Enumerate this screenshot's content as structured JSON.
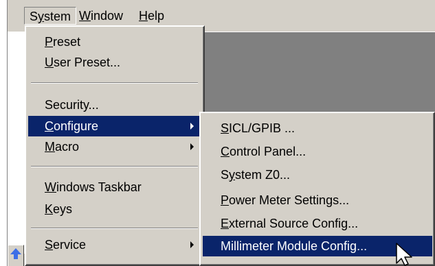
{
  "menubar": {
    "items": [
      {
        "label": "System",
        "mnemonic": "y"
      },
      {
        "label": "Window",
        "mnemonic": "W"
      },
      {
        "label": "Help",
        "mnemonic": "H"
      }
    ]
  },
  "system_menu": {
    "items": [
      {
        "label": "Preset",
        "mnemonic": "P"
      },
      {
        "label": "User Preset...",
        "mnemonic": "U"
      },
      {
        "label": "Security...",
        "mnemonic": ""
      },
      {
        "label": "Configure",
        "mnemonic": "C"
      },
      {
        "label": "Macro",
        "mnemonic": "M"
      },
      {
        "label": "Windows Taskbar",
        "mnemonic": "W"
      },
      {
        "label": "Keys",
        "mnemonic": "K"
      },
      {
        "label": "Service",
        "mnemonic": "S"
      }
    ]
  },
  "configure_submenu": {
    "items": [
      {
        "label": "SICL/GPIB ...",
        "mnemonic": "S"
      },
      {
        "label": "Control Panel...",
        "mnemonic": "C"
      },
      {
        "label": "System Z0...",
        "mnemonic": "y"
      },
      {
        "label": "Power Meter Settings...",
        "mnemonic": "P"
      },
      {
        "label": "External Source Config...",
        "mnemonic": "E"
      },
      {
        "label": "Millimeter Module Config...",
        "mnemonic": ""
      }
    ]
  },
  "icons": {
    "scroll_up": "arrow-up-icon",
    "submenu": "submenu-arrow-icon",
    "pointer": "mouse-pointer-icon"
  },
  "colors": {
    "menu_face": "#d4d0c8",
    "highlight": "#0a246a",
    "client_area": "#808080",
    "scroll_arrow": "#3c6ee6"
  }
}
